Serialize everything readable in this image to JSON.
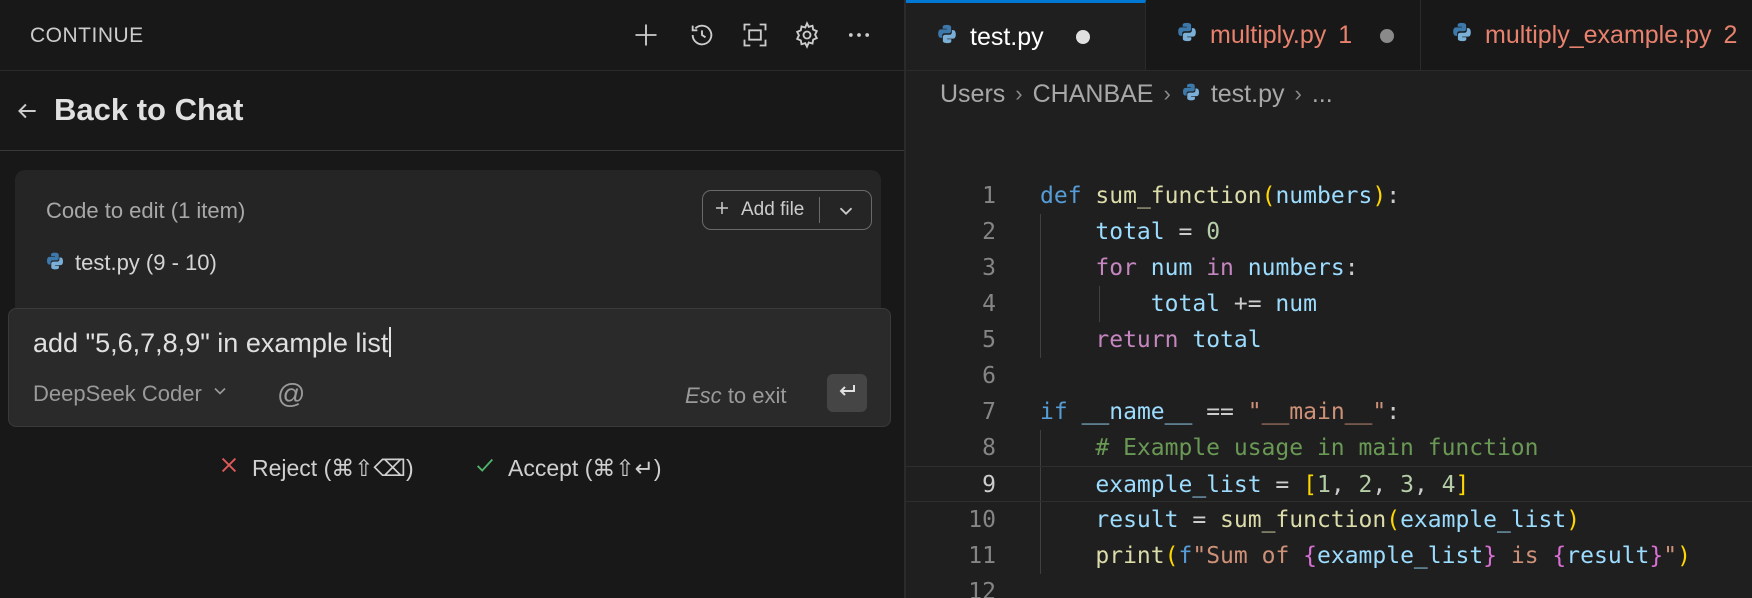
{
  "continue_panel": {
    "title": "CONTINUE",
    "header_icons": [
      "plus-icon",
      "history-icon",
      "fullscreen-icon",
      "gear-icon",
      "more-icon"
    ],
    "back_label": "Back to Chat",
    "code_to_edit": {
      "title": "Code to edit (1 item)",
      "add_file_label": "Add file",
      "file": "test.py (9 - 10)"
    },
    "prompt": {
      "value": "add \"5,6,7,8,9\" in example list",
      "model": "DeepSeek Coder",
      "esc_key": "Esc",
      "esc_suffix": "to exit"
    },
    "actions": {
      "reject": "Reject (⌘⇧⌫)",
      "accept": "Accept (⌘⇧↵)"
    }
  },
  "editor": {
    "tabs": [
      {
        "name": "test.py",
        "badge": "",
        "active": true
      },
      {
        "name": "multiply.py",
        "badge": "1",
        "active": false
      },
      {
        "name": "multiply_example.py",
        "badge": "2",
        "active": false
      }
    ],
    "breadcrumb": [
      "Users",
      "CHANBAE",
      "test.py",
      "..."
    ],
    "current_line": 9,
    "lines": [
      {
        "n": "1",
        "code": "def sum_function(numbers):"
      },
      {
        "n": "2",
        "code": "    total = 0"
      },
      {
        "n": "3",
        "code": "    for num in numbers:"
      },
      {
        "n": "4",
        "code": "        total += num"
      },
      {
        "n": "5",
        "code": "    return total"
      },
      {
        "n": "6",
        "code": ""
      },
      {
        "n": "7",
        "code": "if __name__ == \"__main__\":"
      },
      {
        "n": "8",
        "code": "    # Example usage in main function"
      },
      {
        "n": "9",
        "code": "    example_list = [1, 2, 3, 4]"
      },
      {
        "n": "10",
        "code": "    result = sum_function(example_list)"
      },
      {
        "n": "11",
        "code": "    print(f\"Sum of {example_list} is {result}\")"
      },
      {
        "n": "12",
        "code": ""
      }
    ]
  },
  "colors": {
    "accent": "#0078d4",
    "error_tab": "#e8826e",
    "reject": "#e05a5a",
    "accept": "#4fb36b"
  }
}
